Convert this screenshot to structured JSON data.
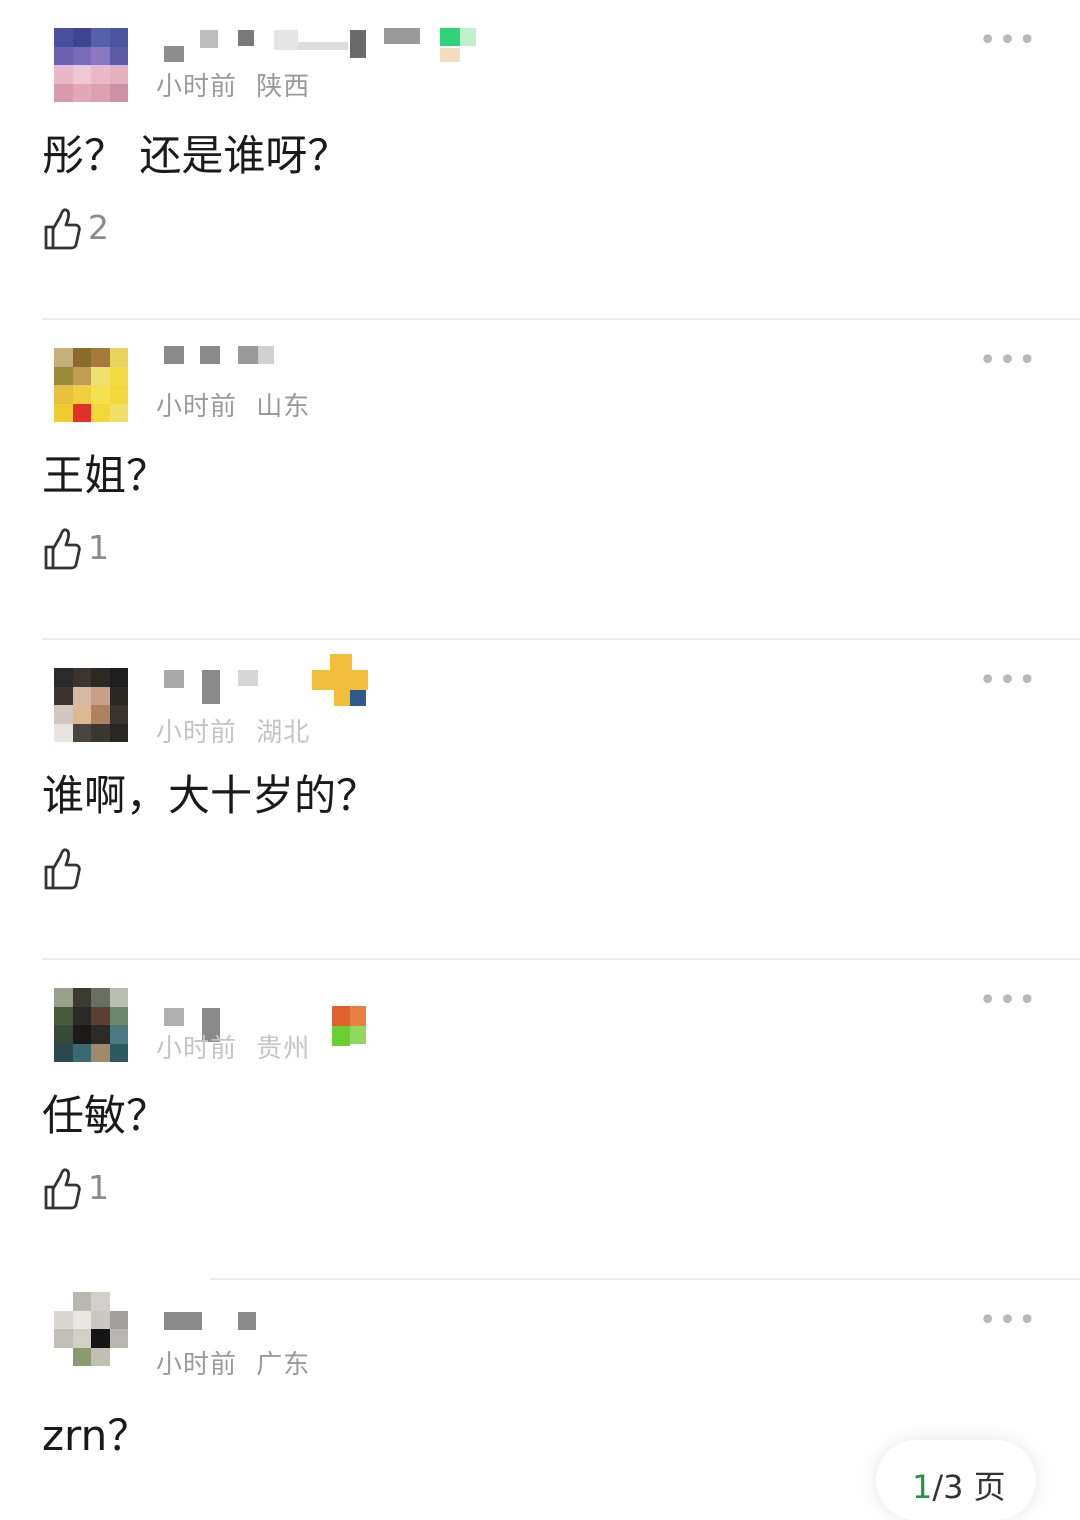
{
  "comments": [
    {
      "time": "小时前",
      "location": "陕西",
      "text": "彤？ 还是谁呀？",
      "likes": "2"
    },
    {
      "time": "小时前",
      "location": "山东",
      "text": "王姐？",
      "likes": "1"
    },
    {
      "time": "小时前",
      "location": "湖北",
      "text": "谁啊，大十岁的？",
      "likes": ""
    },
    {
      "time": "小时前",
      "location": "贵州",
      "text": "任敏？",
      "likes": "1"
    },
    {
      "time": "小时前",
      "location": "广东",
      "text": "zrn？",
      "likes": ""
    }
  ],
  "more_glyph": "•••",
  "pager": {
    "current": "1",
    "total_text": "/3 页"
  },
  "icons": {
    "like": "thumbs-up-icon",
    "more": "more-dots-icon"
  },
  "colors": {
    "accent": "#1a9b3c",
    "meta": "#9a9a9a",
    "divider": "#ececec"
  }
}
